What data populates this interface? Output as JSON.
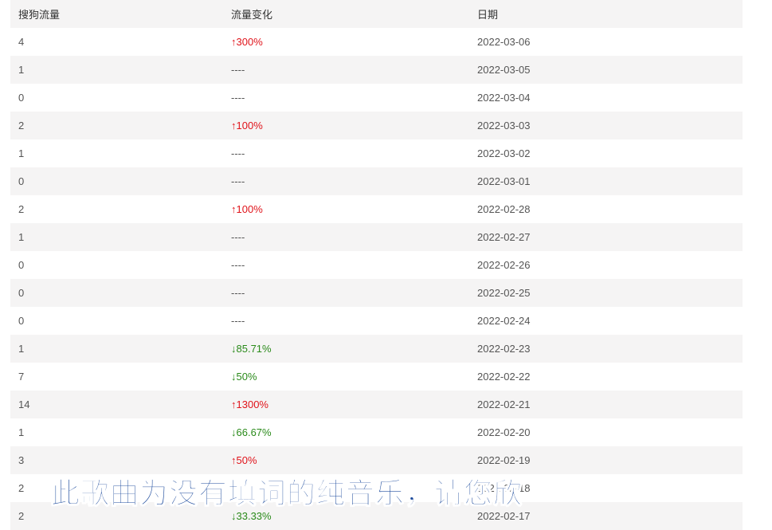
{
  "table": {
    "headers": [
      "搜狗流量",
      "流量变化",
      "日期"
    ],
    "rows": [
      {
        "traffic": "4",
        "change": "↑300%",
        "dir": "up",
        "date": "2022-03-06"
      },
      {
        "traffic": "1",
        "change": "----",
        "dir": "none",
        "date": "2022-03-05"
      },
      {
        "traffic": "0",
        "change": "----",
        "dir": "none",
        "date": "2022-03-04"
      },
      {
        "traffic": "2",
        "change": "↑100%",
        "dir": "up",
        "date": "2022-03-03"
      },
      {
        "traffic": "1",
        "change": "----",
        "dir": "none",
        "date": "2022-03-02"
      },
      {
        "traffic": "0",
        "change": "----",
        "dir": "none",
        "date": "2022-03-01"
      },
      {
        "traffic": "2",
        "change": "↑100%",
        "dir": "up",
        "date": "2022-02-28"
      },
      {
        "traffic": "1",
        "change": "----",
        "dir": "none",
        "date": "2022-02-27"
      },
      {
        "traffic": "0",
        "change": "----",
        "dir": "none",
        "date": "2022-02-26"
      },
      {
        "traffic": "0",
        "change": "----",
        "dir": "none",
        "date": "2022-02-25"
      },
      {
        "traffic": "0",
        "change": "----",
        "dir": "none",
        "date": "2022-02-24"
      },
      {
        "traffic": "1",
        "change": "↓85.71%",
        "dir": "down",
        "date": "2022-02-23"
      },
      {
        "traffic": "7",
        "change": "↓50%",
        "dir": "down",
        "date": "2022-02-22"
      },
      {
        "traffic": "14",
        "change": "↑1300%",
        "dir": "up",
        "date": "2022-02-21"
      },
      {
        "traffic": "1",
        "change": "↓66.67%",
        "dir": "down",
        "date": "2022-02-20"
      },
      {
        "traffic": "3",
        "change": "↑50%",
        "dir": "up",
        "date": "2022-02-19"
      },
      {
        "traffic": "2",
        "change": "",
        "dir": "none",
        "date": "2022-02-18"
      },
      {
        "traffic": "2",
        "change": "↓33.33%",
        "dir": "down",
        "date": "2022-02-17"
      }
    ]
  },
  "colors": {
    "up": "#e0141b",
    "down": "#2a8a1a",
    "row_alt": "#f5f4f4"
  },
  "overlay": {
    "lyric_text": "此歌曲为没有填词的纯音乐，请您欣"
  }
}
